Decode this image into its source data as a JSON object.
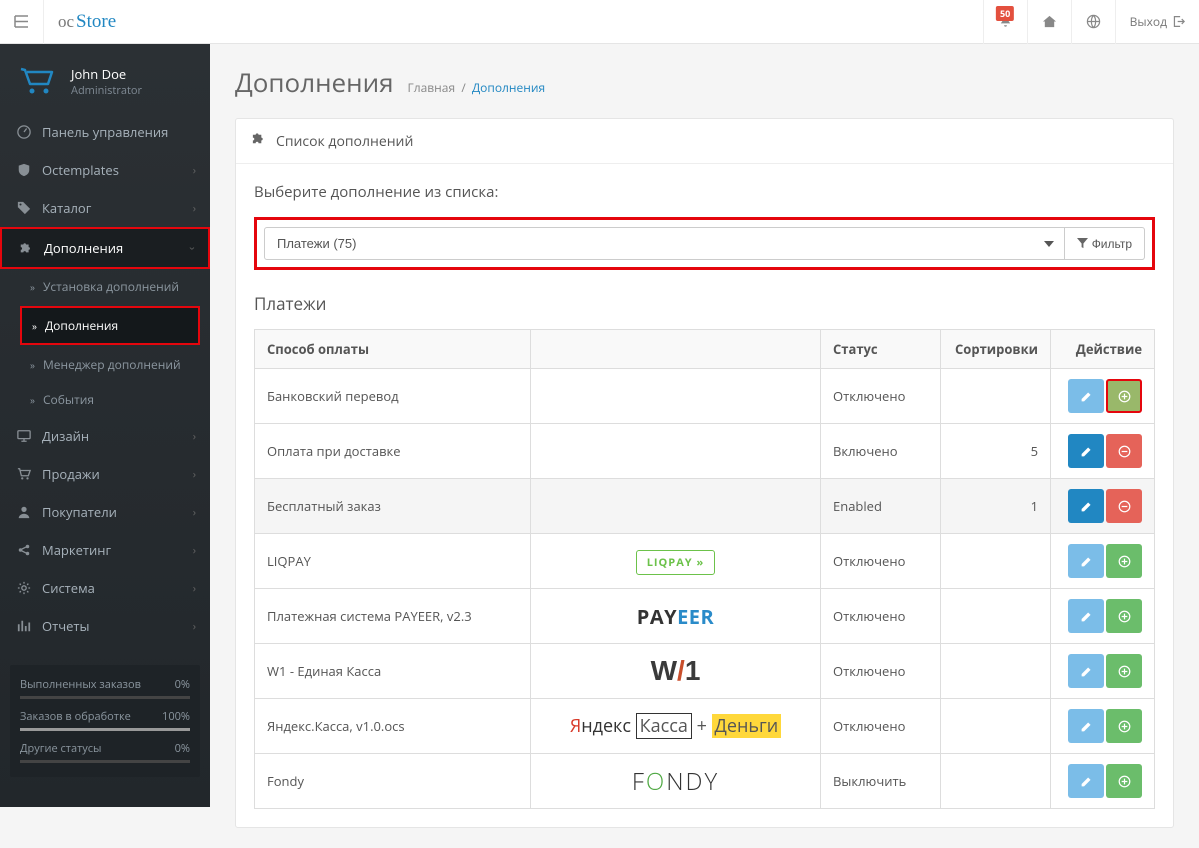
{
  "header": {
    "logo_oc": "oc",
    "logo_store": "Store",
    "notification_count": "50",
    "logout_label": "Выход"
  },
  "profile": {
    "name": "John Doe",
    "role": "Administrator"
  },
  "sidebar": {
    "items": [
      {
        "label": "Панель управления",
        "icon": "dashboard",
        "active": false
      },
      {
        "label": "Octemplates",
        "icon": "shield",
        "chev": true
      },
      {
        "label": "Каталог",
        "icon": "tag",
        "chev": true
      },
      {
        "label": "Дополнения",
        "icon": "puzzle",
        "chev": true,
        "open": true
      },
      {
        "label": "Дизайн",
        "icon": "monitor",
        "chev": true
      },
      {
        "label": "Продажи",
        "icon": "cart",
        "chev": true
      },
      {
        "label": "Покупатели",
        "icon": "user",
        "chev": true
      },
      {
        "label": "Маркетинг",
        "icon": "share",
        "chev": true
      },
      {
        "label": "Система",
        "icon": "cog",
        "chev": true
      },
      {
        "label": "Отчеты",
        "icon": "chart",
        "chev": true
      }
    ],
    "subitems": [
      {
        "label": "Установка дополнений"
      },
      {
        "label": "Дополнения",
        "active": true
      },
      {
        "label": "Менеджер дополнений"
      },
      {
        "label": "События"
      }
    ]
  },
  "stats": {
    "rows": [
      {
        "label": "Выполненных заказов",
        "value": "0%",
        "bar": 0
      },
      {
        "label": "Заказов в обработке",
        "value": "100%",
        "bar": 100
      },
      {
        "label": "Другие статусы",
        "value": "0%",
        "bar": 0
      }
    ]
  },
  "page": {
    "title": "Дополнения",
    "breadcrumb_home": "Главная",
    "breadcrumb_sep": "/",
    "breadcrumb_current": "Дополнения",
    "panel_title": "Список дополнений",
    "intro": "Выберите дополнение из списка:",
    "select_value": "Платежи (75)",
    "filter_label": "Фильтр",
    "section_title": "Платежи",
    "table": {
      "headers": {
        "name": "Способ оплаты",
        "logo": "",
        "status": "Статус",
        "sort": "Сортировки",
        "action": "Действие"
      },
      "rows": [
        {
          "name": "Банковский перевод",
          "status": "Отключено",
          "sort": "",
          "edit": "dis",
          "second": "install-hl",
          "alt": false
        },
        {
          "name": "Оплата при доставке",
          "status": "Включено",
          "sort": "5",
          "edit": "en",
          "second": "uninstall",
          "alt": false
        },
        {
          "name": "Бесплатный заказ",
          "status": "Enabled",
          "sort": "1",
          "edit": "en",
          "second": "uninstall",
          "alt": true
        },
        {
          "name": "LIQPAY",
          "status": "Отключено",
          "sort": "",
          "edit": "dis",
          "second": "install",
          "alt": false,
          "logo": "liqpay"
        },
        {
          "name": "Платежная система PAYEER, v2.3",
          "status": "Отключено",
          "sort": "",
          "edit": "dis",
          "second": "install",
          "alt": false,
          "logo": "payeer"
        },
        {
          "name": "W1 - Единая Касса",
          "status": "Отключено",
          "sort": "",
          "edit": "dis",
          "second": "install",
          "alt": false,
          "logo": "w1"
        },
        {
          "name": "Яндекс.Касса, v1.0.ocs",
          "status": "Отключено",
          "sort": "",
          "edit": "dis",
          "second": "install",
          "alt": false,
          "logo": "yandex"
        },
        {
          "name": "Fondy",
          "status": "Выключить",
          "sort": "",
          "edit": "dis",
          "second": "install",
          "alt": false,
          "logo": "fondy"
        }
      ]
    }
  }
}
